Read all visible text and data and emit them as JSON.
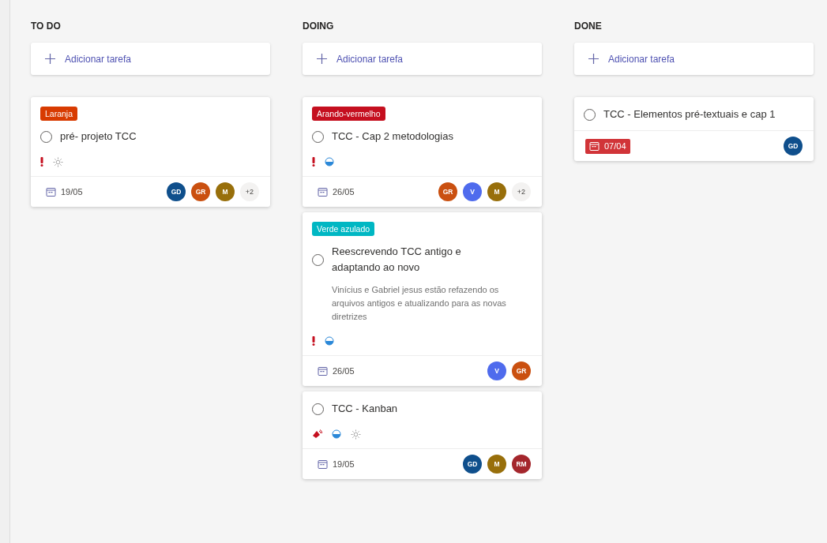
{
  "columns": [
    {
      "title": "TO DO",
      "add_label": "Adicionar tarefa",
      "cards": [
        {
          "label": {
            "text": "Laranja",
            "color": "#d83b01"
          },
          "title": "pré- projeto TCC",
          "completed": false,
          "indicators": [
            {
              "kind": "important"
            },
            {
              "kind": "sun"
            }
          ],
          "due": {
            "text": "19/05",
            "overdue": false
          },
          "assignees": [
            {
              "initials": "GD",
              "color": "#0f4f8c"
            },
            {
              "initials": "GR",
              "color": "#ca5010"
            },
            {
              "initials": "M",
              "color": "#986f0b"
            }
          ],
          "more": "+2"
        }
      ]
    },
    {
      "title": "DOING",
      "add_label": "Adicionar tarefa",
      "cards": [
        {
          "label": {
            "text": "Arando-vermelho",
            "color": "#c50f1f"
          },
          "title": "TCC - Cap 2 metodologias",
          "completed": false,
          "indicators": [
            {
              "kind": "important"
            },
            {
              "kind": "progress"
            }
          ],
          "due": {
            "text": "26/05",
            "overdue": false
          },
          "assignees": [
            {
              "initials": "GR",
              "color": "#ca5010"
            },
            {
              "initials": "V",
              "color": "#4f6bed"
            },
            {
              "initials": "M",
              "color": "#986f0b"
            }
          ],
          "more": "+2"
        },
        {
          "label": {
            "text": "Verde azulado",
            "color": "#00b7c3"
          },
          "title": "Reescrevendo TCC antigo e adaptando ao novo",
          "completed": false,
          "description": "Vinícius e Gabriel jesus estão refazendo os arquivos antigos e atualizando para as novas diretrizes",
          "indicators": [
            {
              "kind": "important"
            },
            {
              "kind": "progress"
            }
          ],
          "due": {
            "text": "26/05",
            "overdue": false
          },
          "assignees": [
            {
              "initials": "V",
              "color": "#4f6bed"
            },
            {
              "initials": "GR",
              "color": "#ca5010"
            }
          ]
        },
        {
          "title": "TCC - Kanban",
          "completed": false,
          "indicators": [
            {
              "kind": "urgent"
            },
            {
              "kind": "progress"
            },
            {
              "kind": "sun"
            }
          ],
          "due": {
            "text": "19/05",
            "overdue": false
          },
          "assignees": [
            {
              "initials": "GD",
              "color": "#0f4f8c"
            },
            {
              "initials": "M",
              "color": "#986f0b"
            },
            {
              "initials": "RM",
              "color": "#a4262c"
            }
          ]
        }
      ]
    },
    {
      "title": "DONE",
      "add_label": "Adicionar tarefa",
      "cards": [
        {
          "title": "TCC - Elementos pré-textuais e cap 1",
          "completed": false,
          "due": {
            "text": "07/04",
            "overdue": true
          },
          "assignees": [
            {
              "initials": "GD",
              "color": "#0f4f8c"
            }
          ]
        }
      ]
    }
  ]
}
